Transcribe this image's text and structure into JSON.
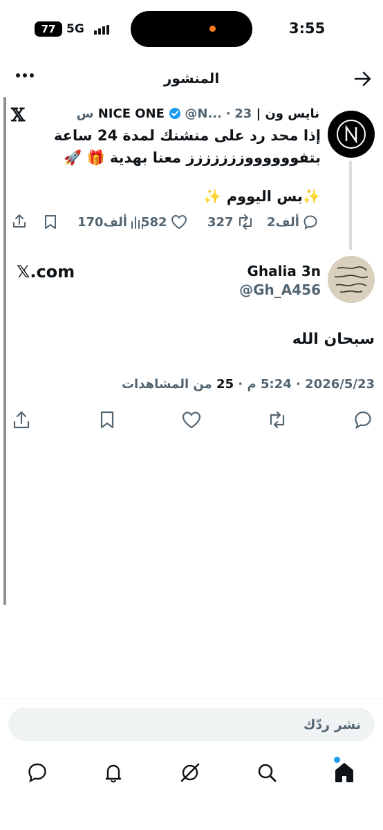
{
  "status_bar": {
    "battery": "77",
    "network": "5G",
    "time": "3:55"
  },
  "header": {
    "title": "المنشور",
    "back_icon": "arrow-right-icon",
    "more_icon": "more-horizontal-icon"
  },
  "quoted_tweet": {
    "author_name": "نايس ون | NICE ONE",
    "handle": "@N...",
    "time": "23 س",
    "separator": "·",
    "text_line1": "إذا محد رد على منشنك لمدة 24 ساعة",
    "text_line2": "بتفووووووززززززز معنا بهدية 🎁 🚀",
    "text_line3": "✨بس اليووم ✨",
    "stats": {
      "replies": "2ألف",
      "retweets": "327",
      "likes": "582",
      "views": "170ألف"
    },
    "source_icon": "x-logo-icon",
    "avatar_letter": "N",
    "colors": {
      "verified": "#1d9bf0"
    }
  },
  "reply": {
    "author_name": "Ghalia 3n",
    "handle": "@Gh_A456",
    "source": "𝕏.com",
    "text": "سبحان الله",
    "date": "2026/5/23",
    "time": "5:24 م",
    "views_count": "25",
    "views_label": "من المشاهدات",
    "separator": "·"
  },
  "composer": {
    "placeholder": "نشر ردّك"
  },
  "bottom_nav": {
    "items": [
      "home-icon",
      "search-icon",
      "grok-icon",
      "notifications-icon",
      "messages-icon"
    ]
  },
  "colors": {
    "text": "#0f1419",
    "secondary": "#536471",
    "accent": "#1d9bf0"
  }
}
